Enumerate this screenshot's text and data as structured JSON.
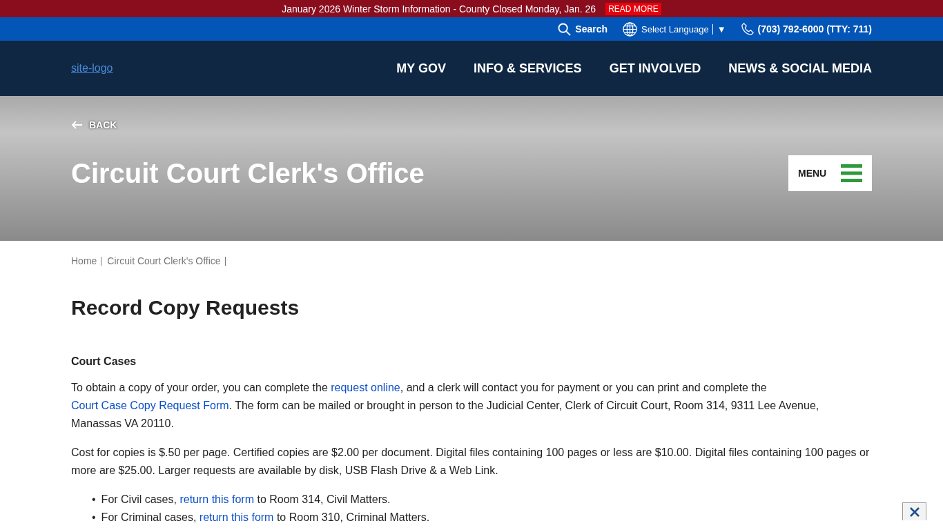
{
  "alert_bar": {
    "message": "January 2026 Winter Storm Information - County Closed Monday, Jan. 26",
    "link": "READ MORE"
  },
  "utility_bar": {
    "search": "Search",
    "language": "Select Language",
    "language_caret": "▼",
    "phone": "(703) 792-6000 (TTY: 711)"
  },
  "header": {
    "logo_alt": "site-logo",
    "nav": [
      "MY GOV",
      "INFO & SERVICES",
      "GET INVOLVED",
      "NEWS & SOCIAL MEDIA"
    ]
  },
  "hero": {
    "back": "BACK",
    "title": "Circuit Court Clerk's Office",
    "menu": "MENU"
  },
  "breadcrumbs": [
    "Home",
    "Circuit Court Clerk's Office"
  ],
  "page_title": "Record Copy Requests",
  "section_heading": "Court Cases",
  "paragraphs": [
    [
      {
        "kind": "text",
        "text": "To obtain a copy of your order,  you can complete the "
      },
      {
        "kind": "link",
        "text": "request online"
      },
      {
        "kind": "text",
        "text": ", and a clerk will contact you for payment or you can print and complete the "
      },
      {
        "kind": "link",
        "text": "Court Case Copy Request Form"
      },
      {
        "kind": "text",
        "text": ".  The form can be mailed or brought in person to the Judicial Center, Clerk of Circuit Court, Room 314, 9311 Lee Avenue, Manassas VA 20110."
      }
    ],
    [
      {
        "kind": "text",
        "text": "Cost for copies is $.50 per page. Certified copies are $2.00 per document. Digital files containing 100 pages or less are $10.00.  Digital files containing 100 pages or more are $25.00. Larger requests are available by disk, USB Flash Drive & a Web Link."
      }
    ]
  ],
  "bullets": [
    {
      "marker": "•",
      "parts": [
        {
          "kind": "text",
          "text": "For Civil cases, "
        },
        {
          "kind": "link",
          "text": "return this form"
        },
        {
          "kind": "text",
          "text": " to Room 314, Civil Matters."
        }
      ]
    },
    {
      "marker": "•",
      "parts": [
        {
          "kind": "text",
          "text": "For Criminal cases, "
        },
        {
          "kind": "link",
          "text": "return this form"
        },
        {
          "kind": "text",
          "text": " to Room 310, Criminal Matters."
        }
      ]
    }
  ]
}
